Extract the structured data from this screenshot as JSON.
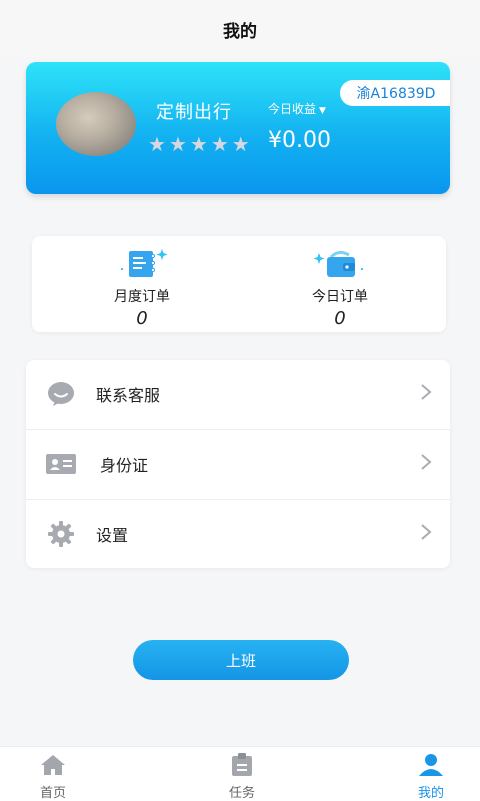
{
  "header": {
    "title": "我的"
  },
  "profile": {
    "company": "定制出行",
    "today_label": "今日收益",
    "today_arrow": "▼",
    "plate": "渝A16839D",
    "earnings": "¥0.00",
    "rating": {
      "value": 5,
      "max": 5
    }
  },
  "stats": [
    {
      "icon": "calendar-icon",
      "label": "月度订单",
      "value": "0"
    },
    {
      "icon": "wallet-icon",
      "label": "今日订单",
      "value": "0"
    }
  ],
  "menu": [
    {
      "icon": "chat-bubble-icon",
      "label": "联系客服"
    },
    {
      "icon": "id-card-icon",
      "label": "身份证"
    },
    {
      "icon": "gear-icon",
      "label": "设置"
    }
  ],
  "start_button": {
    "label": "上班"
  },
  "tabs": [
    {
      "icon": "home-icon",
      "label": "首页",
      "active": false
    },
    {
      "icon": "clipboard-icon",
      "label": "任务",
      "active": false
    },
    {
      "icon": "user-icon",
      "label": "我的",
      "active": true
    }
  ],
  "colors": {
    "accent": "#1a96e8",
    "card_gradient_top": "#2ee3f8",
    "card_gradient_bottom": "#0a96ee",
    "icon_gray": "#9aa0a8"
  }
}
